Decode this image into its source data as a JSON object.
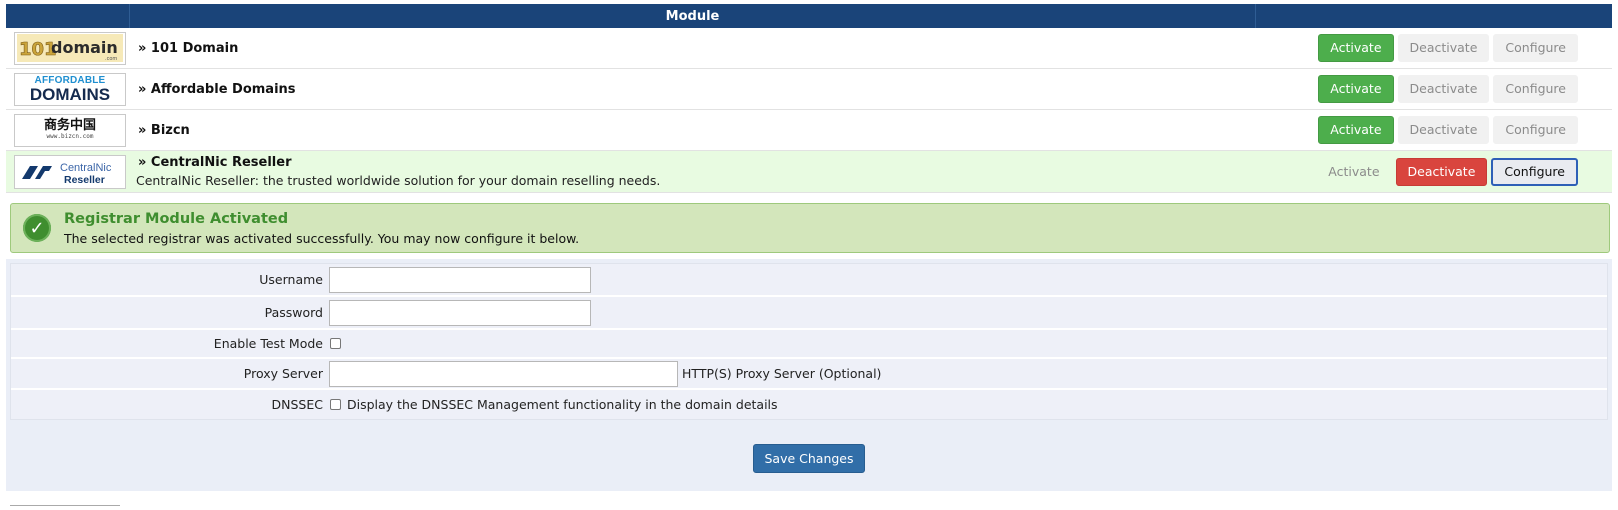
{
  "table": {
    "header": "Module"
  },
  "modules": [
    {
      "name": "» 101 Domain",
      "logo": "101domain",
      "activate": "Activate",
      "deactivate": "Deactivate",
      "configure": "Configure"
    },
    {
      "name": "» Affordable Domains",
      "logo": "affordable-domains",
      "activate": "Activate",
      "deactivate": "Deactivate",
      "configure": "Configure"
    },
    {
      "name": "» Bizcn",
      "logo": "bizcn",
      "activate": "Activate",
      "deactivate": "Deactivate",
      "configure": "Configure"
    },
    {
      "name": "» CentralNic Reseller",
      "logo": "centralnic-reseller",
      "description": "CentralNic Reseller: the trusted worldwide solution for your domain reselling needs.",
      "activate": "Activate",
      "deactivate": "Deactivate",
      "configure": "Configure"
    }
  ],
  "logos": {
    "l101": {
      "num": "101",
      "word": "domain",
      "sub": ".com"
    },
    "affordable": {
      "line1": "AFFORDABLE",
      "line2": "DOMAINS"
    },
    "bizcn": {
      "cn": "商务中国",
      "url": "www.bizcn.com"
    },
    "centralnic": {
      "line1": "CentralNic",
      "line2": "Reseller"
    }
  },
  "alert": {
    "title": "Registrar Module Activated",
    "message": "The selected registrar was activated successfully. You may now configure it below."
  },
  "config": {
    "username_label": "Username",
    "username_value": "",
    "password_label": "Password",
    "password_value": "",
    "test_mode_label": "Enable Test Mode",
    "proxy_label": "Proxy Server",
    "proxy_value": "",
    "proxy_help": "HTTP(S) Proxy Server (Optional)",
    "dnssec_label": "DNSSEC",
    "dnssec_help": "Display the DNSSEC Management functionality in the domain details",
    "save_label": "Save Changes"
  },
  "colors": {
    "header": "#1a4479",
    "activate": "#4dae4c",
    "deactivate_active": "#d9453e",
    "active_row": "#e8fbe1",
    "alert_bg": "#d3e6bb",
    "save": "#316ea8"
  }
}
